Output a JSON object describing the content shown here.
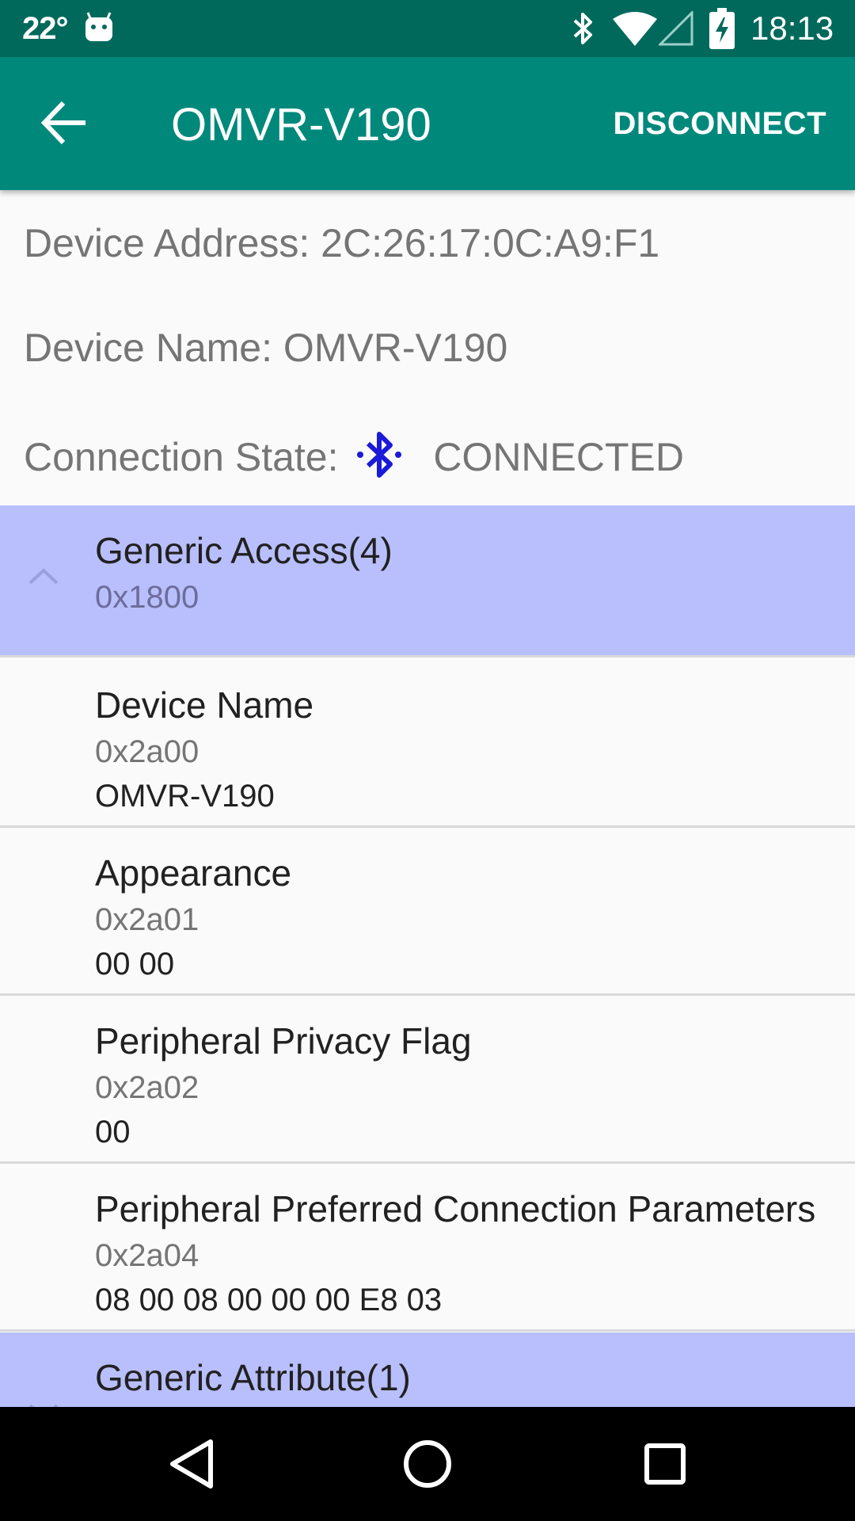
{
  "status_bar": {
    "temperature": "22°",
    "time": "18:13",
    "icons": [
      "android-icon",
      "bluetooth-icon",
      "wifi-icon",
      "cell-signal-icon",
      "battery-charging-icon"
    ]
  },
  "app_bar": {
    "title": "OMVR-V190",
    "action_label": "DISCONNECT",
    "back_icon": "arrow-left-icon"
  },
  "device_info": {
    "address_text": "Device Address: 2C:26:17:0C:A9:F1",
    "name_text": "Device Name: OMVR-V190",
    "connection_label": "Connection State:",
    "connection_value": "CONNECTED",
    "connection_icon": "bluetooth-connected-icon"
  },
  "services": [
    {
      "name": "Generic Access(4)",
      "uuid": "0x1800",
      "expanded": true,
      "characteristics": [
        {
          "name": "Device Name",
          "uuid": "0x2a00",
          "value": "OMVR-V190"
        },
        {
          "name": "Appearance",
          "uuid": "0x2a01",
          "value": "00 00"
        },
        {
          "name": "Peripheral Privacy Flag",
          "uuid": "0x2a02",
          "value": "00"
        },
        {
          "name": "Peripheral Preferred Connection Parameters",
          "uuid": "0x2a04",
          "value": "08 00 08 00 00 00 E8 03"
        }
      ]
    },
    {
      "name": "Generic Attribute(1)",
      "expanded": false
    }
  ],
  "colors": {
    "status_bar": "#00695c",
    "app_bar": "#00897b",
    "service_header": "#b9bffd",
    "bluetooth_blue": "#1a1ad8"
  },
  "nav_bar": {
    "icons": [
      "back-triangle-icon",
      "home-circle-icon",
      "recents-square-icon"
    ]
  }
}
